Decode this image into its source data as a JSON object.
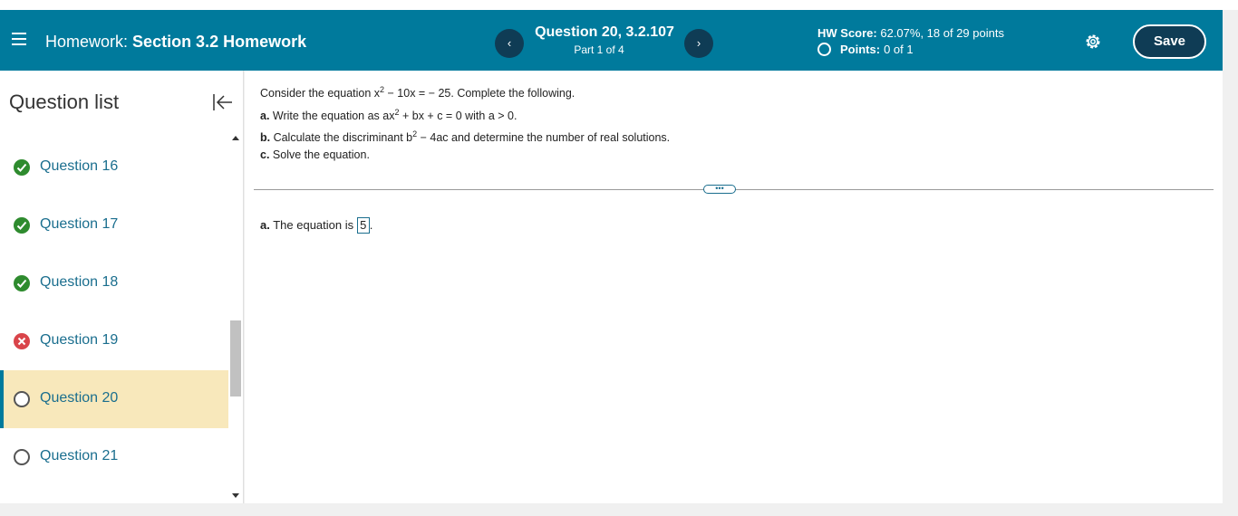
{
  "header": {
    "hw_prefix": "Homework:",
    "hw_name": "Section 3.2 Homework",
    "prev_label": "‹",
    "next_label": "›",
    "question_title": "Question 20, 3.2.107",
    "question_part": "Part 1 of 4",
    "score_label": "HW Score:",
    "score_value": "62.07%, 18 of 29 points",
    "points_label": "Points:",
    "points_value": "0 of 1",
    "save_label": "Save"
  },
  "sidebar": {
    "title": "Question list",
    "items": [
      {
        "label": "Question 16",
        "status": "correct"
      },
      {
        "label": "Question 17",
        "status": "correct"
      },
      {
        "label": "Question 18",
        "status": "correct"
      },
      {
        "label": "Question 19",
        "status": "incorrect"
      },
      {
        "label": "Question 20",
        "status": "current"
      },
      {
        "label": "Question 21",
        "status": "unanswered"
      }
    ]
  },
  "problem": {
    "intro_1": "Consider the equation x",
    "intro_exp": "2",
    "intro_2": " − 10x = − 25. Complete the following.",
    "a_label": "a.",
    "a_text_1": " Write the equation as ax",
    "a_exp": "2",
    "a_text_2": " + bx + c = 0 with a > 0.",
    "b_label": "b.",
    "b_text_1": " Calculate the discriminant b",
    "b_exp": "2",
    "b_text_2": " − 4ac and determine the number of real solutions.",
    "c_label": "c.",
    "c_text": " Solve the equation.",
    "more_label": "•••"
  },
  "answer": {
    "label": "a.",
    "text": " The equation is ",
    "value": "5",
    "suffix": "."
  },
  "colors": {
    "header_bg": "#007a9c",
    "button_dark": "#0f3c55",
    "link": "#1a6e8e",
    "correct": "#2e8b2e",
    "incorrect": "#d9444a",
    "active_bg": "#f8e8bb"
  },
  "icons": [
    "hamburger-icon",
    "gear-icon",
    "collapse-icon",
    "check-icon",
    "x-icon",
    "circle-icon"
  ]
}
